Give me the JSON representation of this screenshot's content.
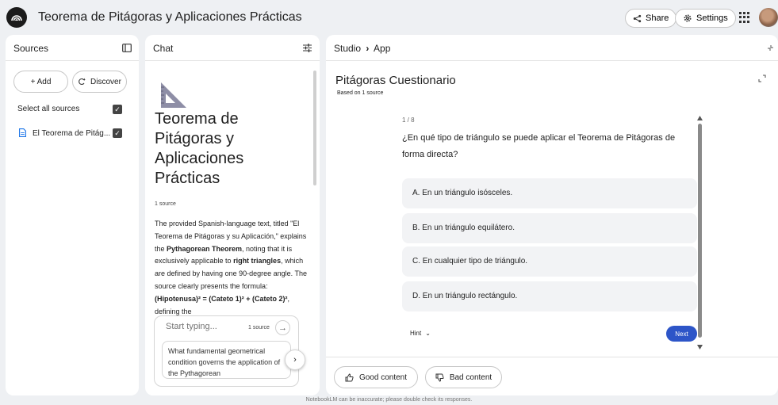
{
  "app": {
    "title": "Teorema de Pitágoras y Aplicaciones Prácticas"
  },
  "header": {
    "share_label": "Share",
    "settings_label": "Settings"
  },
  "sources": {
    "title": "Sources",
    "add_label": "+ Add",
    "discover_label": "Discover",
    "select_all_label": "Select all sources",
    "items": [
      {
        "label": "El Teorema de Pitág..."
      }
    ]
  },
  "chat": {
    "title": "Chat",
    "notebook_title": "Teorema de Pitágoras y Aplicaciones Prácticas",
    "source_count": "1 source",
    "summary": {
      "p1": "The provided Spanish-language text, titled \"El Teorema de Pitágoras y su Aplicación,\" explains the ",
      "b1": "Pythagorean Theorem",
      "p2": ", noting that it is exclusively applicable to ",
      "b2": "right triangles",
      "p3": ", which are defined by having one 90-degree angle. The source clearly presents the formula: ",
      "b3": "(Hipotenusa)² = (Cateto 1)² + (Cateto 2)²",
      "p4": ", defining the"
    },
    "input_placeholder": "Start typing...",
    "input_source_count": "1 source",
    "suggestion": "What fundamental geometrical condition governs the application of the Pythagorean"
  },
  "studio": {
    "breadcrumb_root": "Studio",
    "breadcrumb_sep": "›",
    "breadcrumb_current": "App",
    "quiz_title": "Pitágoras Cuestionario",
    "quiz_subtitle": "Based on 1 source",
    "progress": "1 / 8",
    "question": "¿En qué tipo de triángulo se puede aplicar el Teorema de Pitágoras de forma directa?",
    "options": [
      "A.  En un triángulo isósceles.",
      "B.  En un triángulo equilátero.",
      "C.  En cualquier tipo de triángulo.",
      "D.  En un triángulo rectángulo."
    ],
    "hint_label": "Hint",
    "next_label": "Next",
    "good_content_label": "Good content",
    "bad_content_label": "Bad content"
  },
  "footer": {
    "disclaimer": "NotebookLM can be inaccurate; please double check its responses."
  },
  "colors": {
    "accent": "#2d55c8",
    "background": "#eef0f3",
    "option_bg": "#f2f3f5"
  }
}
